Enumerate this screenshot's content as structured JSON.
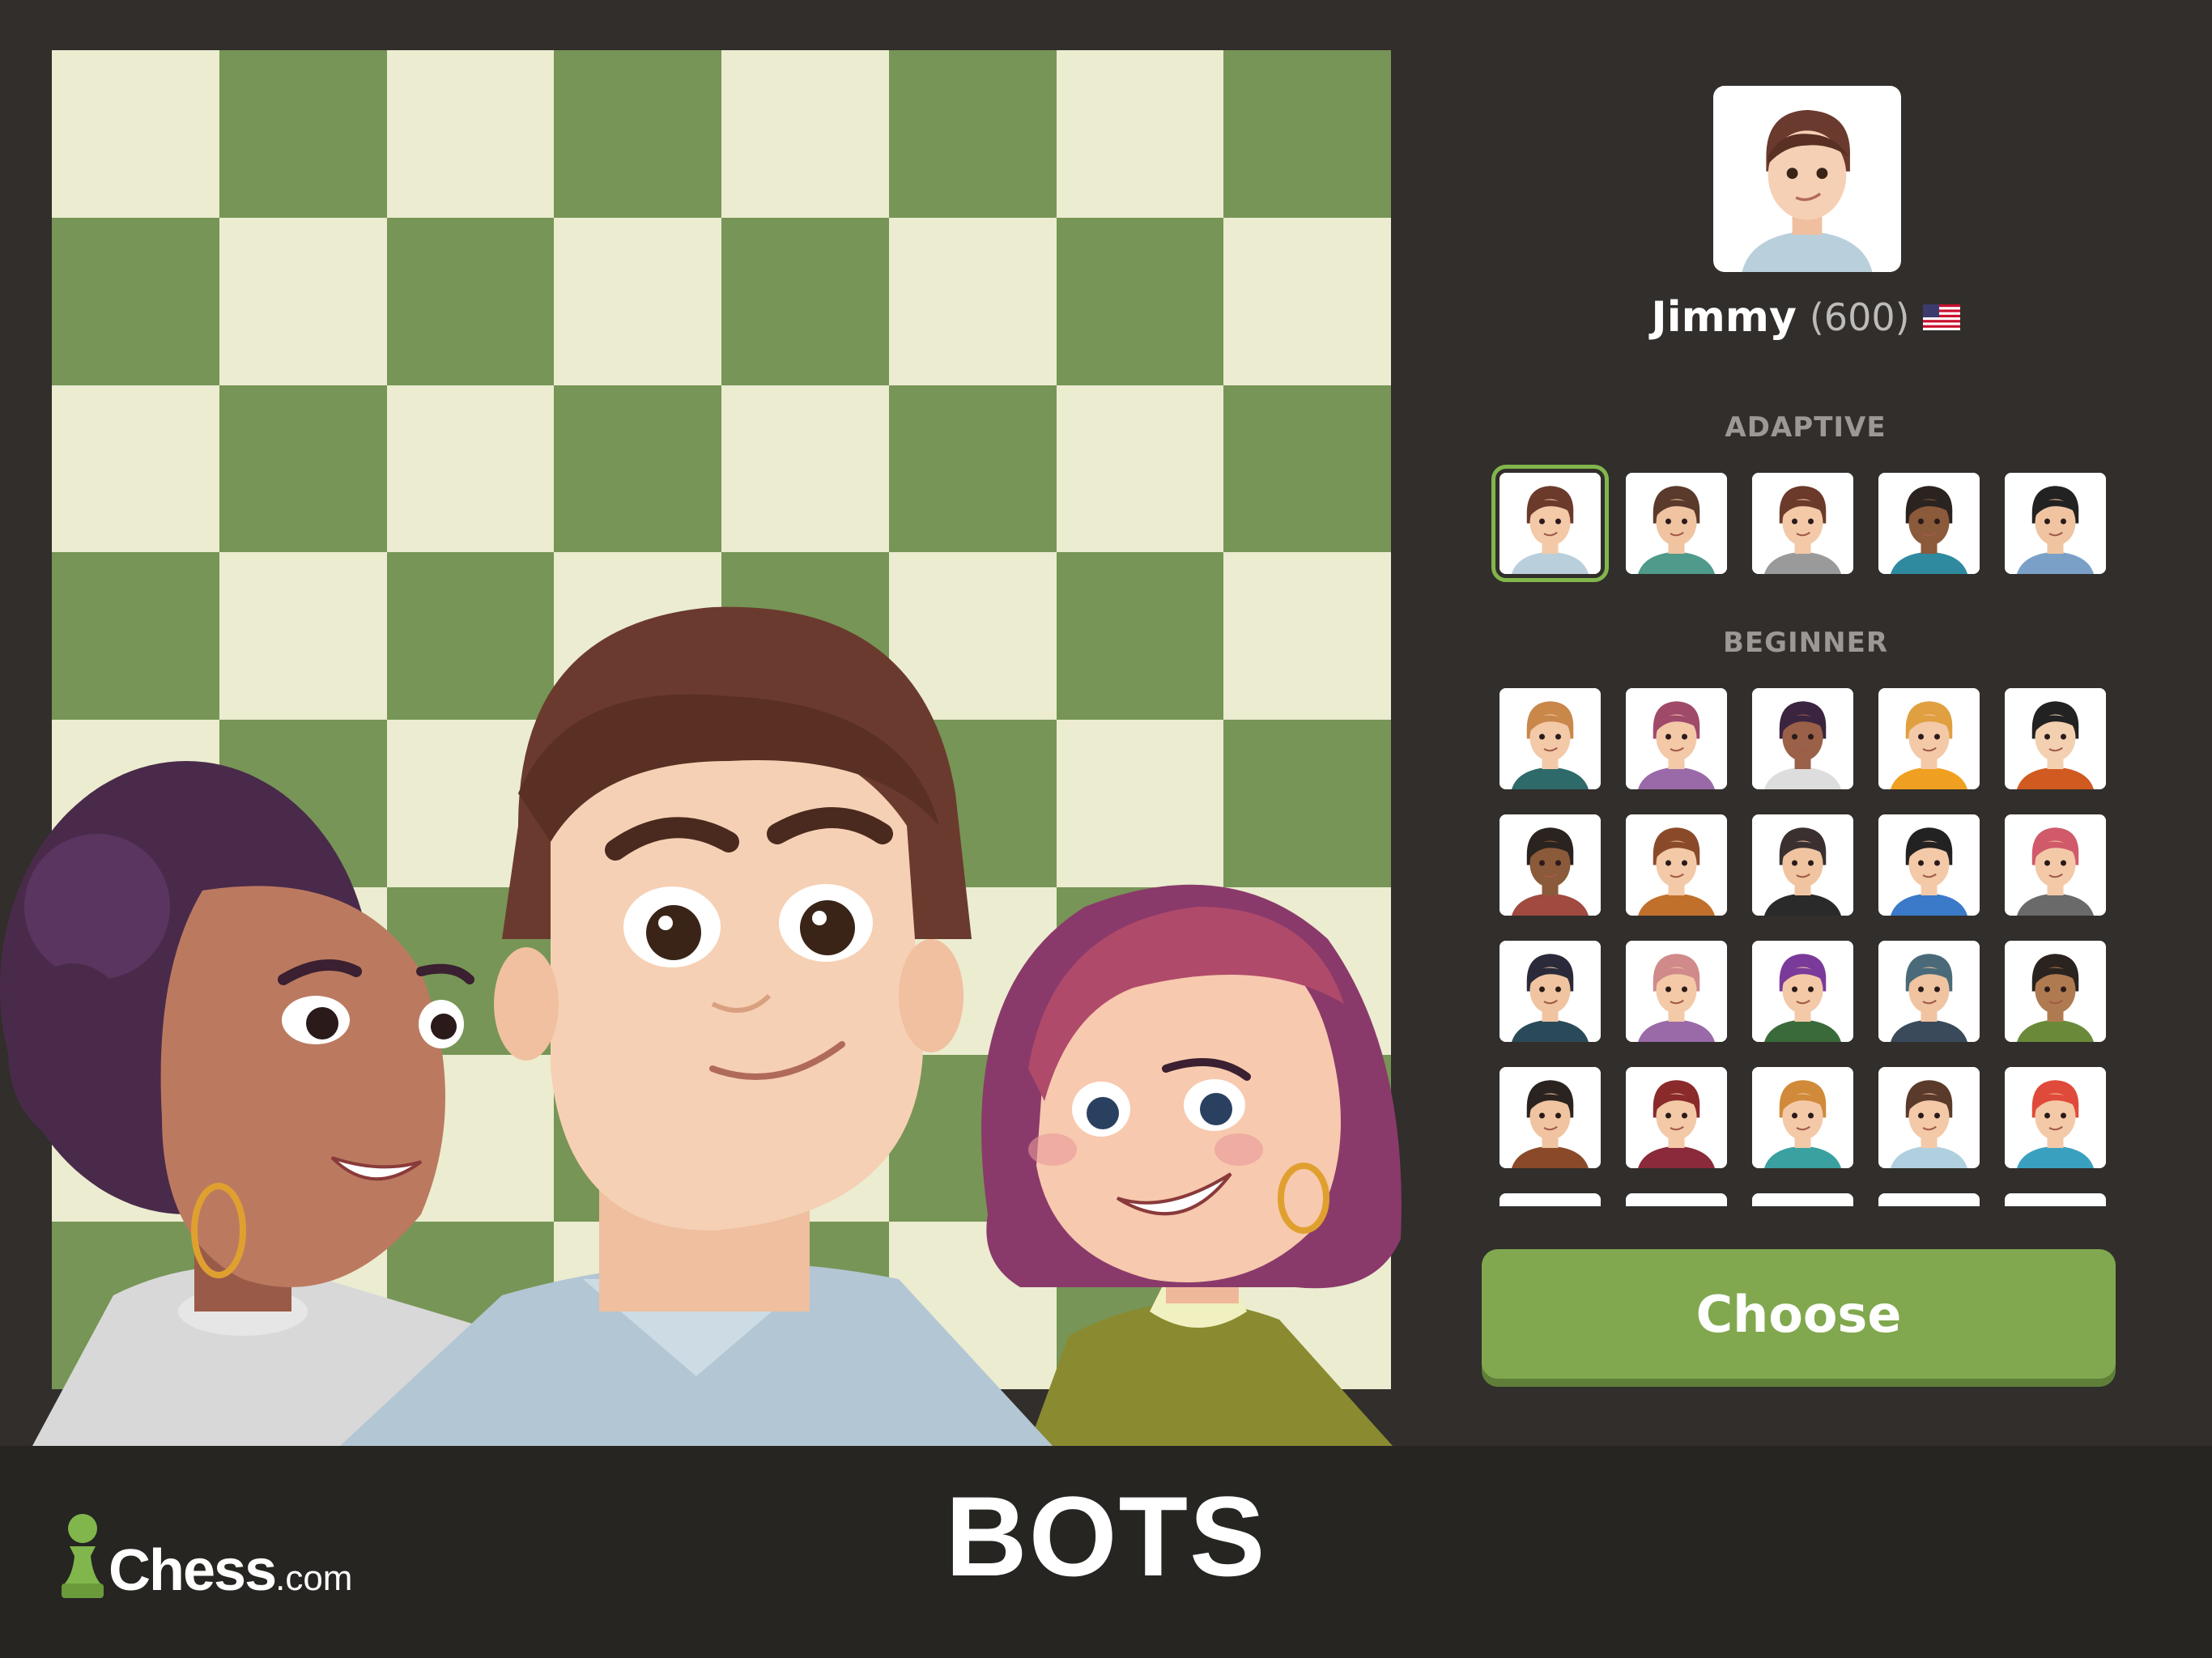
{
  "selected_bot": {
    "name": "Jimmy",
    "rating": "(600)",
    "flag": "us-flag-icon"
  },
  "sections": {
    "adaptive_label": "ADAPTIVE",
    "beginner_label": "BEGINNER"
  },
  "adaptive_bots": [
    {
      "hair": "#6b3a2a",
      "skin": "#f3c9a8",
      "shirt": "#b9cfdc",
      "selected": true
    },
    {
      "hair": "#5a3a2a",
      "skin": "#f0c4a0",
      "shirt": "#4f9a8a"
    },
    {
      "hair": "#6b3a2a",
      "skin": "#f3c9a8",
      "shirt": "#9a9a9a"
    },
    {
      "hair": "#2a2320",
      "skin": "#8a5a3a",
      "shirt": "#2f8aa0"
    },
    {
      "hair": "#222222",
      "skin": "#f0c4a0",
      "shirt": "#7aa0c8"
    }
  ],
  "beginner_rows": [
    [
      {
        "hair": "#c9874a",
        "skin": "#f3c9a8",
        "shirt": "#2f6a6a"
      },
      {
        "hair": "#a04a6a",
        "skin": "#f3c9a8",
        "shirt": "#9a6aa8"
      },
      {
        "hair": "#3a2440",
        "skin": "#9a6048",
        "shirt": "#dddddd"
      },
      {
        "hair": "#e0a040",
        "skin": "#f3c9a8",
        "shirt": "#f0a020"
      },
      {
        "hair": "#222222",
        "skin": "#f3d0b0",
        "shirt": "#d05a20"
      }
    ],
    [
      {
        "hair": "#2a2320",
        "skin": "#8a5a3a",
        "shirt": "#a04a40"
      },
      {
        "hair": "#8a4a2a",
        "skin": "#f3c9a8",
        "shirt": "#c0702a"
      },
      {
        "hair": "#3a3030",
        "skin": "#f0c4a0",
        "shirt": "#2a2a2a"
      },
      {
        "hair": "#222222",
        "skin": "#f3c9a8",
        "shirt": "#3a7ac8"
      },
      {
        "hair": "#d05a6a",
        "skin": "#f3c9a8",
        "shirt": "#6a6a6a"
      }
    ],
    [
      {
        "hair": "#2a2a3a",
        "skin": "#f0c4a0",
        "shirt": "#2a4a5a"
      },
      {
        "hair": "#d08a8a",
        "skin": "#f3c9a8",
        "shirt": "#9a6aa8"
      },
      {
        "hair": "#7a3a9a",
        "skin": "#f3c9a8",
        "shirt": "#3a6a3a"
      },
      {
        "hair": "#4a6a7a",
        "skin": "#f0c4a0",
        "shirt": "#3a4a5a"
      },
      {
        "hair": "#2a2320",
        "skin": "#b07a50",
        "shirt": "#6a8a3a"
      }
    ],
    [
      {
        "hair": "#2a2320",
        "skin": "#f0c4a0",
        "shirt": "#8a4a2a"
      },
      {
        "hair": "#8a2a2a",
        "skin": "#f3c9a8",
        "shirt": "#8a2a3a"
      },
      {
        "hair": "#d08a3a",
        "skin": "#f3c9a8",
        "shirt": "#3aa0a0"
      },
      {
        "hair": "#5a3a2a",
        "skin": "#f3c9a8",
        "shirt": "#b0d0e0"
      },
      {
        "hair": "#e04a3a",
        "skin": "#f3c9a8",
        "shirt": "#3aa0c0"
      }
    ],
    [
      {
        "hair": "#444444",
        "skin": "#f3c9a8",
        "shirt": "#555555"
      },
      {
        "hair": "#444444",
        "skin": "#f3c9a8",
        "shirt": "#555555"
      },
      {
        "hair": "#444444",
        "skin": "#f3c9a8",
        "shirt": "#555555"
      },
      {
        "hair": "#444444",
        "skin": "#f3c9a8",
        "shirt": "#555555"
      },
      {
        "hair": "#444444",
        "skin": "#f3c9a8",
        "shirt": "#555555"
      }
    ]
  ],
  "choose_button": "Choose",
  "footer": {
    "logo_main": "Chess",
    "logo_suffix": ".com",
    "title": "BOTS"
  },
  "colors": {
    "board_light": "#ebecd0",
    "board_dark": "#779556",
    "accent_green": "#81b64c",
    "background": "#312e2b"
  }
}
